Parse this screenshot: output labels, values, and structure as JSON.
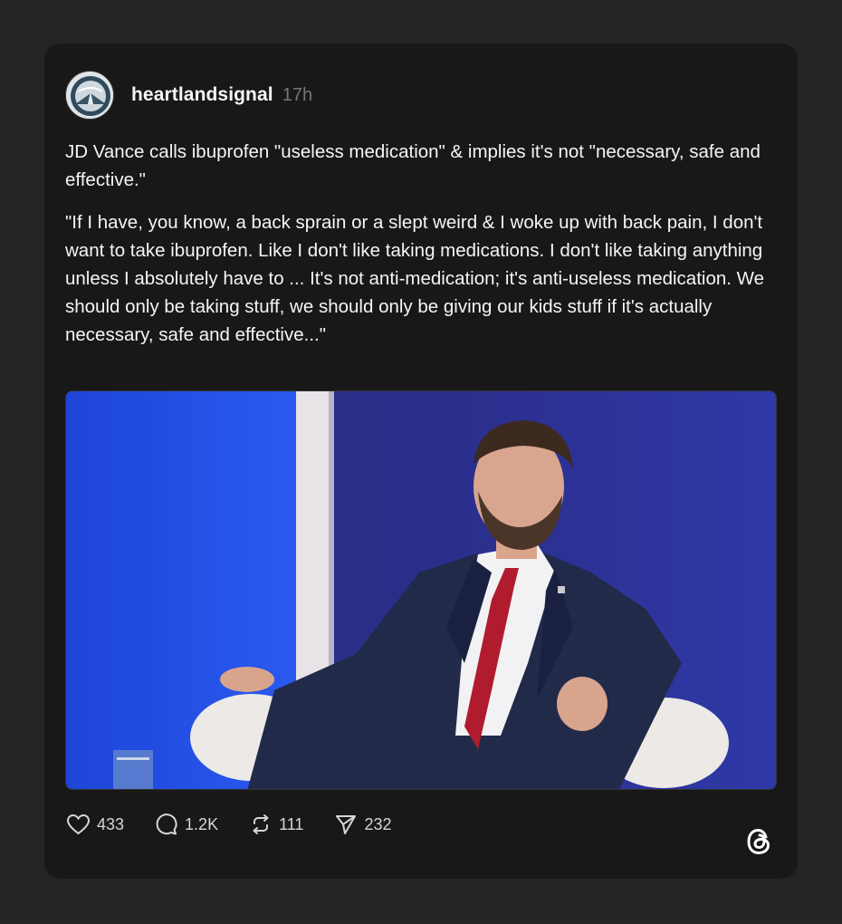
{
  "post": {
    "username": "heartlandsignal",
    "timestamp": "17h",
    "paragraph1": "JD Vance calls ibuprofen \"useless medication\" & implies it's not \"necessary, safe and effective.\"",
    "paragraph2": "\"If I have, you know, a back sprain or a slept weird & I woke up with back pain, I don't want to take ibuprofen. Like I don't like taking medications. I don't like taking anything unless I absolutely have to ... It's not anti-medication; it's anti-useless medication. We should only be taking stuff, we should only be giving our kids stuff if it's actually necessary, safe and effective...\""
  },
  "actions": {
    "likes": "433",
    "replies": "1.2K",
    "reposts": "111",
    "shares": "232"
  },
  "icons": {
    "like": "heart-icon",
    "reply": "comment-bubble-icon",
    "repost": "repost-icon",
    "share": "send-icon",
    "brand": "threads-logo-icon"
  },
  "colors": {
    "background": "#242426",
    "card": "#181818",
    "text": "#f3f5f7",
    "muted": "#777777"
  }
}
